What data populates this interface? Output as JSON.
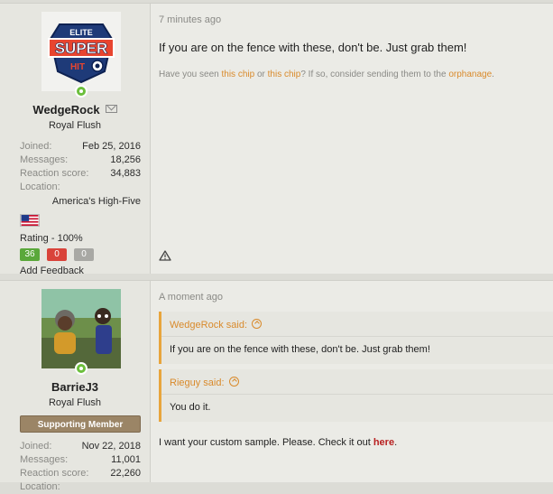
{
  "posts": [
    {
      "user": {
        "avatar_text_top": "ELITE",
        "avatar_text_mid": "SUPER",
        "avatar_text_bot": "HIT",
        "name": "WedgeRock",
        "title": "Royal Flush",
        "stats": [
          {
            "k": "Joined:",
            "v": "Feb 25, 2016"
          },
          {
            "k": "Messages:",
            "v": "18,256"
          },
          {
            "k": "Reaction score:",
            "v": "34,883"
          },
          {
            "k": "Location:",
            "v": ""
          }
        ],
        "location": "America's High-Five",
        "rating": "Rating - 100%",
        "feedback": [
          {
            "v": "36",
            "color": "#5aa83a"
          },
          {
            "v": "0",
            "color": "#d9433a"
          },
          {
            "v": "0",
            "color": "#a8a8a4"
          }
        ],
        "add_feedback": "Add Feedback"
      },
      "time": "7 minutes ago",
      "message": "If you are on the fence with these, don't be. Just grab them!",
      "signature": {
        "p1": "Have you seen ",
        "l1": "this chip",
        "p2": " or ",
        "l2": "this chip",
        "p3": "? If so, consider sending them to the ",
        "l3": "orphanage",
        "p4": "."
      }
    },
    {
      "user": {
        "name": "BarrieJ3",
        "title": "Royal Flush",
        "badge": "Supporting Member",
        "stats": [
          {
            "k": "Joined:",
            "v": "Nov 22, 2018"
          },
          {
            "k": "Messages:",
            "v": "11,001"
          },
          {
            "k": "Reaction score:",
            "v": "22,260"
          },
          {
            "k": "Location:",
            "v": ""
          }
        ]
      },
      "time": "A moment ago",
      "quotes": [
        {
          "author": "WedgeRock said:",
          "text": "If you are on the fence with these, don't be. Just grab them!"
        },
        {
          "author": "Rieguy said:",
          "text": "You do it."
        }
      ],
      "reply": {
        "p1": "I want your custom sample. Please. Check it out ",
        "link": "here",
        "p2": "."
      }
    }
  ]
}
